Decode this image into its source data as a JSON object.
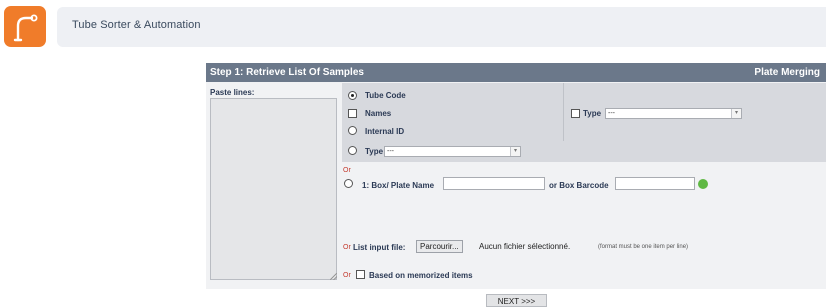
{
  "header": {
    "app_icon": "robotic-arm-icon",
    "title": "Tube Sorter & Automation",
    "accent_color": "#f07c2a"
  },
  "panel": {
    "step_title": "Step 1: Retrieve List Of Samples",
    "mode_title": "Plate Merging",
    "paste_label": "Paste lines:",
    "options": {
      "tube_code": "Tube Code",
      "names": "Names",
      "internal_id": "Internal ID",
      "type_label": "Type",
      "type_right_label": "Type",
      "type_value": "---",
      "type_right_value": "---"
    },
    "or_text": "Or",
    "box_name_label": "1: Box/ Plate Name",
    "box_barcode_label": "or Box Barcode",
    "list_file_label": "List input file:",
    "browse_label": "Parcourir...",
    "no_file_text": "Aucun fichier sélectionné.",
    "file_note": "(format must be one item per line)",
    "memorized_label": "Based on memorized items"
  },
  "next_label": "NEXT >>>"
}
